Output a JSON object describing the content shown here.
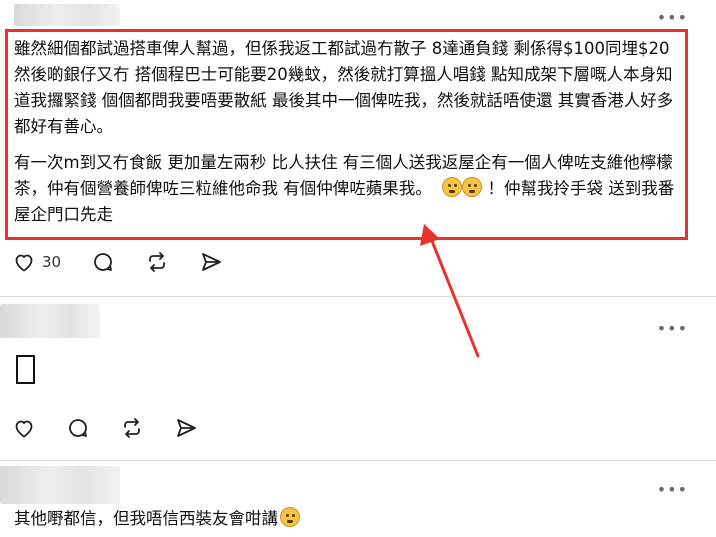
{
  "post1": {
    "paragraph1": "雖然細個都試過搭車俾人幫過，但係我返工都試過冇散子 8達通負錢 剩係得$100同埋$20然後啲銀仔又冇 搭個程巴士可能要20幾蚊，然後就打算搵人唱錢 點知成架下層嘅人本身知道我攞緊錢 個個都問我要唔要散紙 最後其中一個俾咗我，然後就話唔使還 其實香港人好多都好有善心。",
    "paragraph2_part1": "有一次m到又冇食飯 更加量左兩秒 比人扶住￼ 有三個人送我返屋企有一個人俾咗支維他檸檬茶，仲有個營養師俾咗三粒維他命我 有個仲俾咗蘋果我。",
    "paragraph2_part2": "！仲幫我拎手袋 送到我番屋企門口先走",
    "like_count": "30"
  },
  "post3": {
    "text": "其他嘢都信，但我唔信西裝友會咁講"
  },
  "colors": {
    "highlight": "#e8332a",
    "arrow": "#e8332a"
  },
  "icons": [
    "heart-icon",
    "comment-icon",
    "repost-icon",
    "share-icon",
    "more-icon"
  ]
}
